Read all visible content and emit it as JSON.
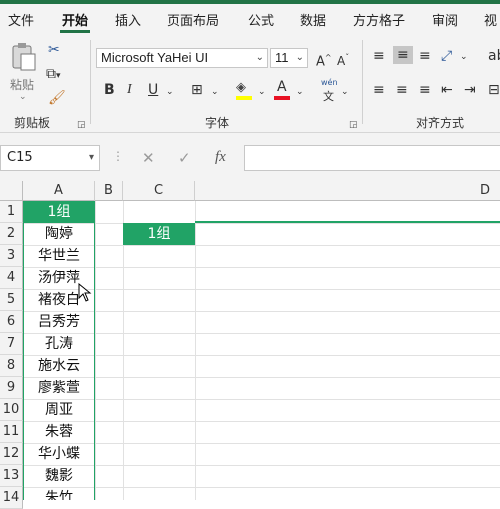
{
  "menu": {
    "tabs": [
      "文件",
      "开始",
      "插入",
      "页面布局",
      "公式",
      "数据",
      "方方格子",
      "审阅",
      "视"
    ],
    "active_tab": "开始"
  },
  "ribbon": {
    "clipboard": {
      "label": "剪贴板",
      "paste_label": "粘贴"
    },
    "font": {
      "label": "字体",
      "font_name": "Microsoft YaHei UI",
      "font_size": "11",
      "phonetic_top": "wén",
      "phonetic_bottom": "文"
    },
    "alignment": {
      "label": "对齐方式"
    }
  },
  "formula_bar": {
    "name_box": "C15",
    "formula": ""
  },
  "columns": [
    "A",
    "B",
    "C",
    "D"
  ],
  "rows": [
    "1",
    "2",
    "3",
    "4",
    "5",
    "6",
    "7",
    "8",
    "9",
    "10",
    "11",
    "12",
    "13",
    "14"
  ],
  "column_a": [
    "1组",
    "陶婷",
    "华世兰",
    "汤伊萍",
    "褚夜白",
    "吕秀芳",
    "孔涛",
    "施水云",
    "廖紫萱",
    "周亚",
    "朱蓉",
    "华小蝶",
    "魏影",
    "朱竹"
  ],
  "c2_value": "1组",
  "colors": {
    "accent": "#217346",
    "header_fill": "#21a366"
  }
}
